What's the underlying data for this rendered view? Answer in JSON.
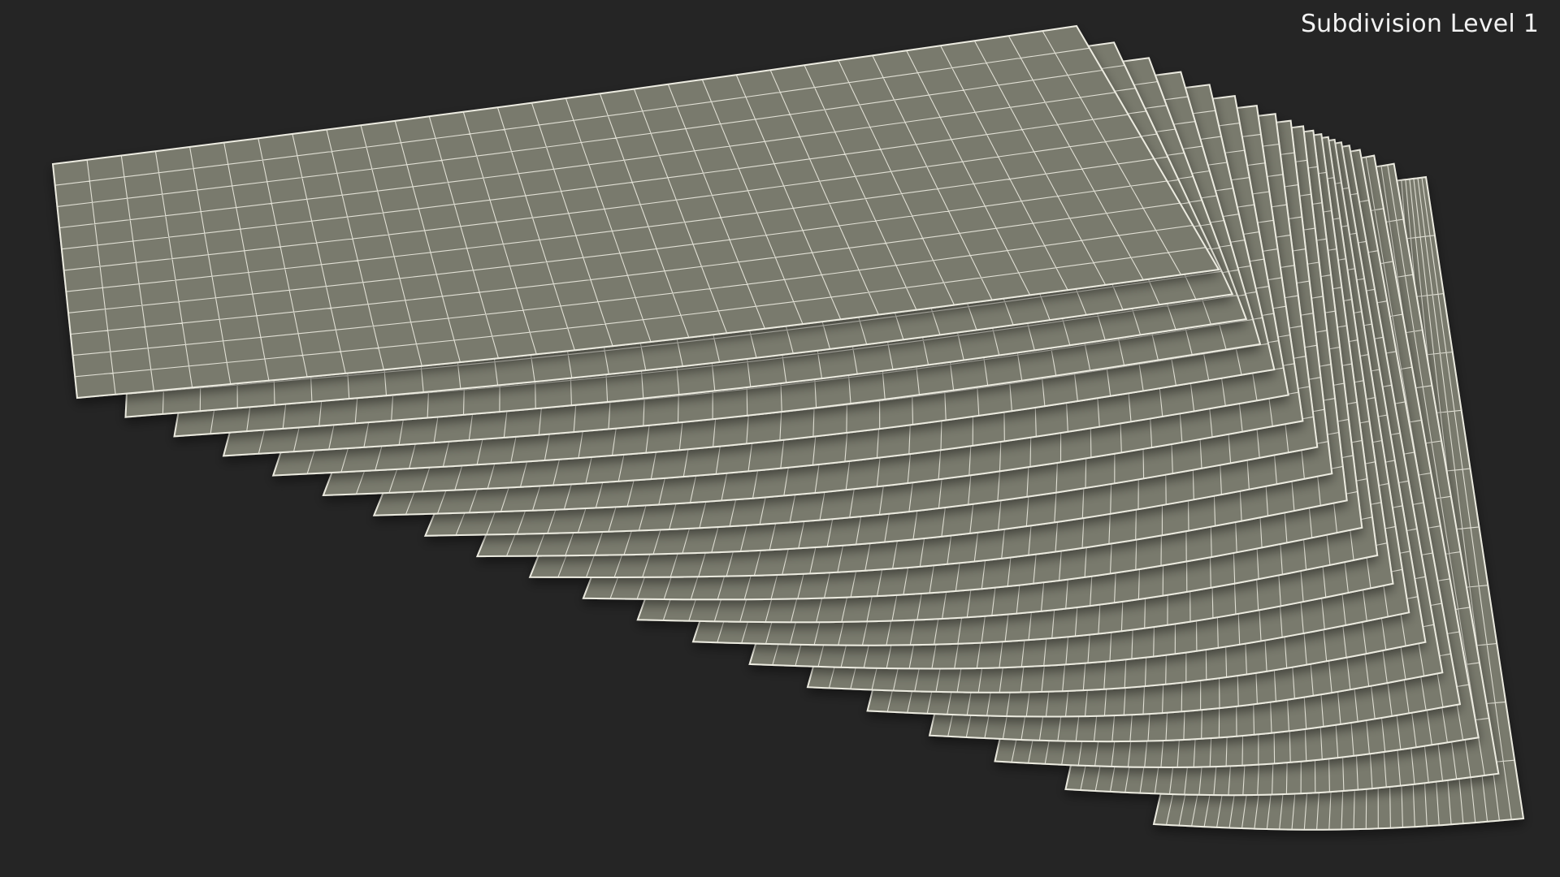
{
  "overlay": {
    "label": "Subdivision Level 1"
  },
  "viewport": {
    "background_color": "#252525"
  },
  "model": {
    "subject": "fanned stack of paper sheets",
    "display_mode": "wireframe on shaded",
    "sheet_fill_color": "#797a6d",
    "wire_color": "#ecebe0",
    "sheet_count": 20
  }
}
